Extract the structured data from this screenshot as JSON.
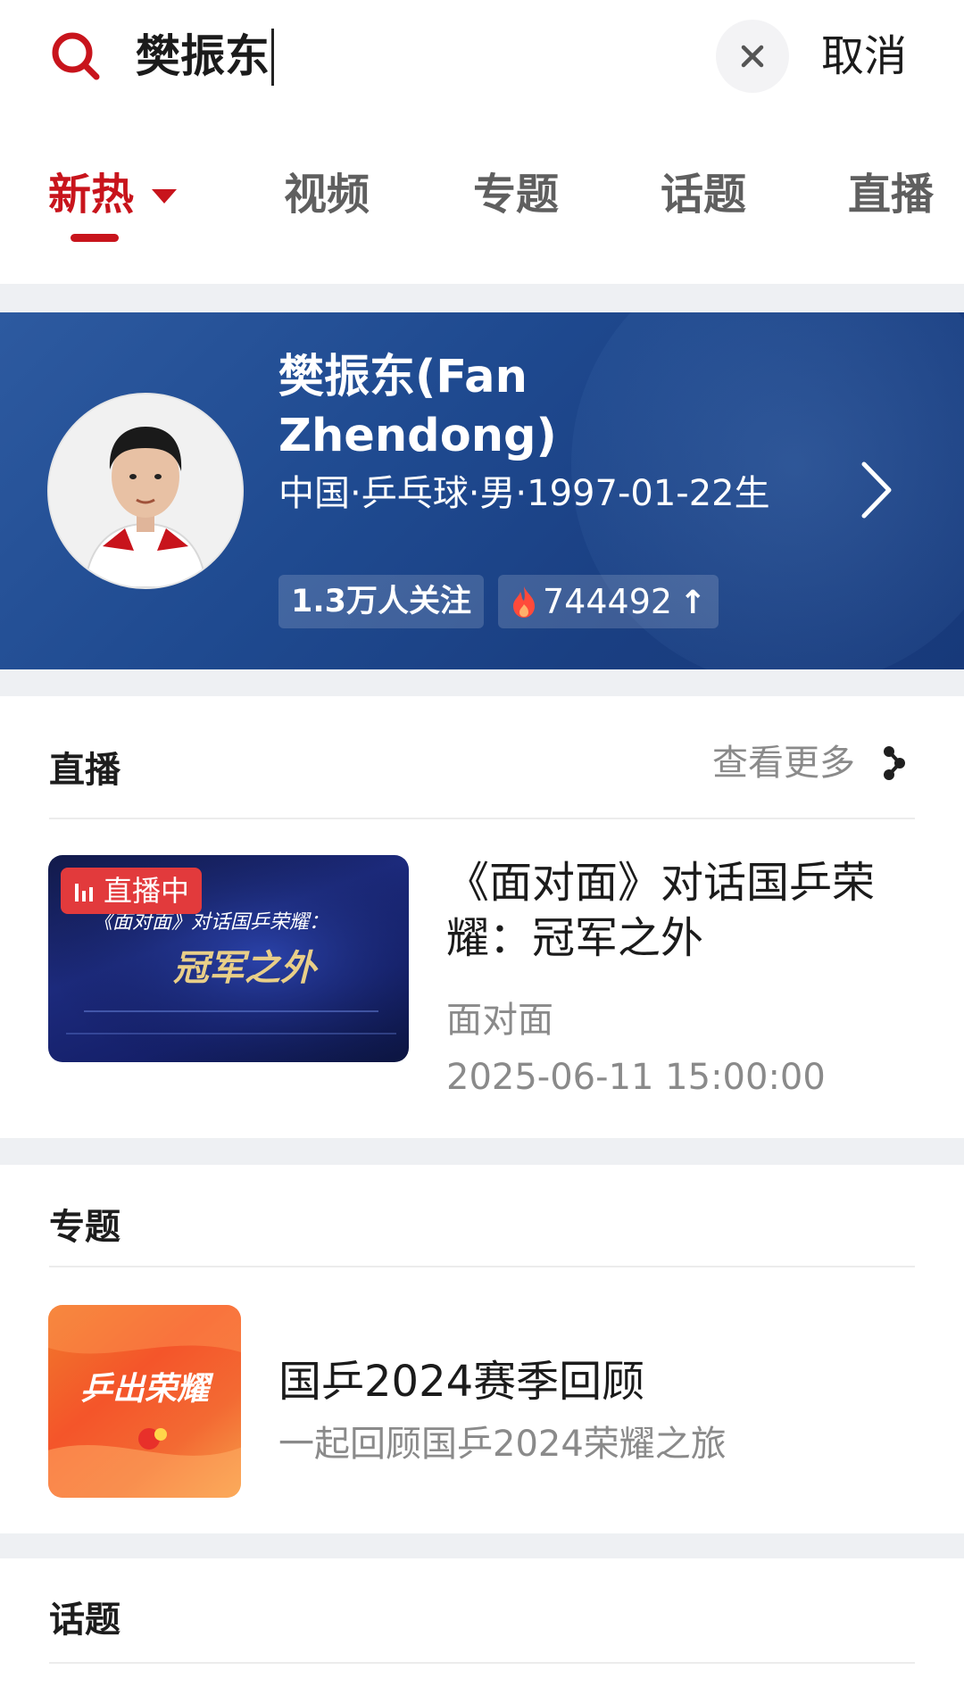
{
  "search": {
    "query": "樊振东",
    "cancel_label": "取消"
  },
  "tabs": [
    {
      "label": "新热",
      "active": true
    },
    {
      "label": "视频"
    },
    {
      "label": "专题"
    },
    {
      "label": "话题"
    },
    {
      "label": "直播"
    }
  ],
  "athlete": {
    "name": "樊振东(Fan Zhendong)",
    "info": "中国·乒乓球·男·1997-01-22生",
    "followers": "1.3万人关注",
    "heat": "744492"
  },
  "live_section": {
    "title": "直播",
    "more_label": "查看更多",
    "item": {
      "badge": "直播中",
      "thumb_line1": "《面对面》对话国乒荣耀：",
      "thumb_line2": "冠军之外",
      "title": "《面对面》对话国乒荣耀：冠军之外",
      "source": "面对面",
      "time": "2025-06-11 15:00:00"
    }
  },
  "topic_section": {
    "title": "专题",
    "item": {
      "thumb_text": "乒出荣耀",
      "title": "国乒2024赛季回顾",
      "desc": "一起回顾国乒2024荣耀之旅"
    }
  },
  "hashtag_section": {
    "title": "话题"
  },
  "colors": {
    "accent": "#c8141c",
    "hero_bg": "#1f4a90",
    "live_badge": "#e23a3c"
  }
}
